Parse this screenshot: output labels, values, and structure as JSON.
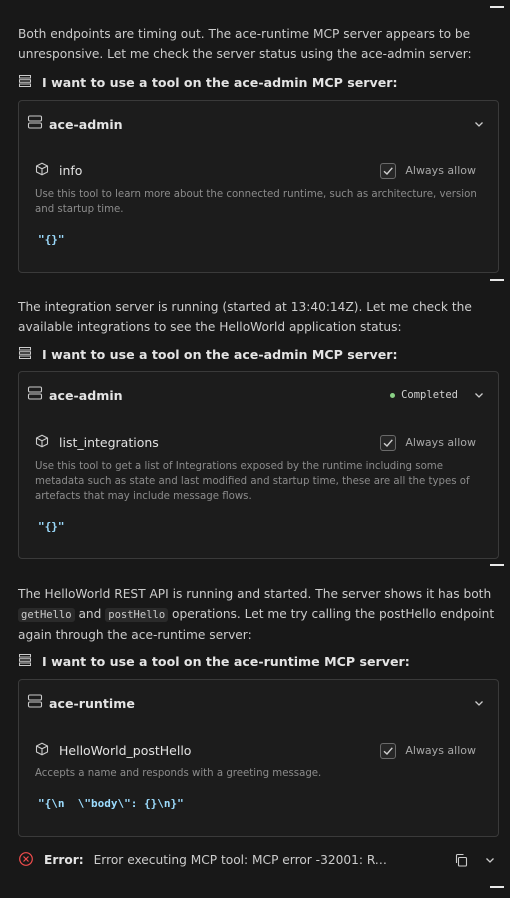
{
  "messages": {
    "m1": "Both endpoints are timing out. The ace-runtime MCP server appears to be unresponsive. Let me check the server status using the ace-admin server:",
    "m2": "The integration server is running (started at 13:40:14Z). Let me check the available integrations to see the HelloWorld application status:",
    "m3_part1": "The HelloWorld REST API is running and started. The server shows it has both ",
    "m3_code1": "getHello",
    "m3_and": " and ",
    "m3_code2": "postHello",
    "m3_part2": " operations. Let me try calling the postHello endpoint again through the ace-runtime server:"
  },
  "tool_calls": [
    {
      "heading": "I want to use a tool on the ace-admin MCP server:",
      "server": "ace-admin",
      "status": "",
      "tool": "info",
      "always_allow": "Always allow",
      "description": "Use this tool to learn more about the connected runtime, such as architecture, version and startup time.",
      "input": "\"{}\""
    },
    {
      "heading": "I want to use a tool on the ace-admin MCP server:",
      "server": "ace-admin",
      "status": "Completed",
      "tool": "list_integrations",
      "always_allow": "Always allow",
      "description": "Use this tool to get a list of Integrations exposed by the runtime including some metadata such as state and last modified and startup time, these are all the types of artefacts that may include message flows.",
      "input": "\"{}\""
    },
    {
      "heading": "I want to use a tool on the ace-runtime MCP server:",
      "server": "ace-runtime",
      "status": "",
      "tool": "HelloWorld_postHello",
      "always_allow": "Always allow",
      "description": "Accepts a name and responds with a greeting message.",
      "input": "\"{\\n  \\\"body\\\": {}\\n}\""
    }
  ],
  "error": {
    "label": "Error:",
    "text": "Error executing MCP tool: MCP error -32001: Requ..."
  },
  "colors": {
    "background": "#181818",
    "card": "#1c1c1c",
    "border": "#3a3a3a",
    "completed_dot": "#89d185",
    "error": "#f14c4c",
    "json": "#9cdcfe"
  }
}
